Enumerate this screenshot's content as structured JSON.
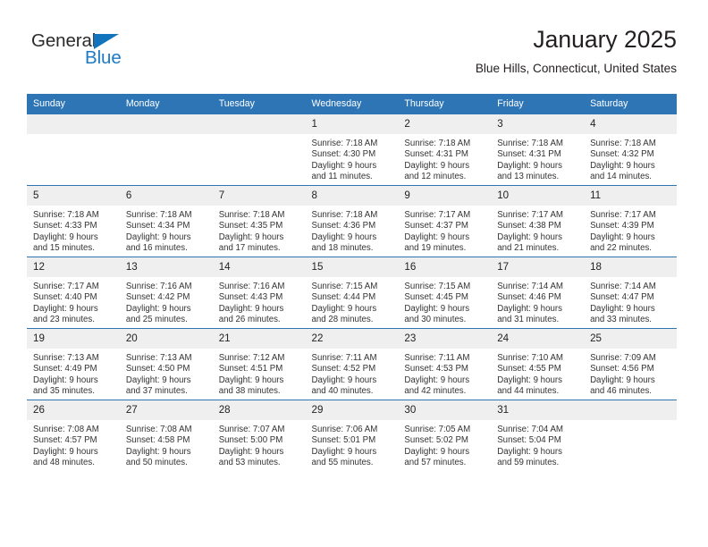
{
  "brand": {
    "name_part1": "General",
    "name_part2": "Blue",
    "logo_icon": "triangle-icon",
    "colors": {
      "blue": "#1d7ac4",
      "dark": "#2b2b2b"
    }
  },
  "header": {
    "title": "January 2025",
    "subtitle": "Blue Hills, Connecticut, United States"
  },
  "theme": {
    "header_blue": "#2e75b6",
    "daynum_background": "#efefef",
    "text": "#231f20"
  },
  "calendar": {
    "weekday_headers": [
      "Sunday",
      "Monday",
      "Tuesday",
      "Wednesday",
      "Thursday",
      "Friday",
      "Saturday"
    ],
    "weeks": [
      [
        {
          "day": "",
          "empty": true,
          "sunrise": "",
          "sunset": "",
          "daylight_line1": "",
          "daylight_line2": ""
        },
        {
          "day": "",
          "empty": true,
          "sunrise": "",
          "sunset": "",
          "daylight_line1": "",
          "daylight_line2": ""
        },
        {
          "day": "",
          "empty": true,
          "sunrise": "",
          "sunset": "",
          "daylight_line1": "",
          "daylight_line2": ""
        },
        {
          "day": "1",
          "empty": false,
          "sunrise": "Sunrise: 7:18 AM",
          "sunset": "Sunset: 4:30 PM",
          "daylight_line1": "Daylight: 9 hours",
          "daylight_line2": "and 11 minutes."
        },
        {
          "day": "2",
          "empty": false,
          "sunrise": "Sunrise: 7:18 AM",
          "sunset": "Sunset: 4:31 PM",
          "daylight_line1": "Daylight: 9 hours",
          "daylight_line2": "and 12 minutes."
        },
        {
          "day": "3",
          "empty": false,
          "sunrise": "Sunrise: 7:18 AM",
          "sunset": "Sunset: 4:31 PM",
          "daylight_line1": "Daylight: 9 hours",
          "daylight_line2": "and 13 minutes."
        },
        {
          "day": "4",
          "empty": false,
          "sunrise": "Sunrise: 7:18 AM",
          "sunset": "Sunset: 4:32 PM",
          "daylight_line1": "Daylight: 9 hours",
          "daylight_line2": "and 14 minutes."
        }
      ],
      [
        {
          "day": "5",
          "empty": false,
          "sunrise": "Sunrise: 7:18 AM",
          "sunset": "Sunset: 4:33 PM",
          "daylight_line1": "Daylight: 9 hours",
          "daylight_line2": "and 15 minutes."
        },
        {
          "day": "6",
          "empty": false,
          "sunrise": "Sunrise: 7:18 AM",
          "sunset": "Sunset: 4:34 PM",
          "daylight_line1": "Daylight: 9 hours",
          "daylight_line2": "and 16 minutes."
        },
        {
          "day": "7",
          "empty": false,
          "sunrise": "Sunrise: 7:18 AM",
          "sunset": "Sunset: 4:35 PM",
          "daylight_line1": "Daylight: 9 hours",
          "daylight_line2": "and 17 minutes."
        },
        {
          "day": "8",
          "empty": false,
          "sunrise": "Sunrise: 7:18 AM",
          "sunset": "Sunset: 4:36 PM",
          "daylight_line1": "Daylight: 9 hours",
          "daylight_line2": "and 18 minutes."
        },
        {
          "day": "9",
          "empty": false,
          "sunrise": "Sunrise: 7:17 AM",
          "sunset": "Sunset: 4:37 PM",
          "daylight_line1": "Daylight: 9 hours",
          "daylight_line2": "and 19 minutes."
        },
        {
          "day": "10",
          "empty": false,
          "sunrise": "Sunrise: 7:17 AM",
          "sunset": "Sunset: 4:38 PM",
          "daylight_line1": "Daylight: 9 hours",
          "daylight_line2": "and 21 minutes."
        },
        {
          "day": "11",
          "empty": false,
          "sunrise": "Sunrise: 7:17 AM",
          "sunset": "Sunset: 4:39 PM",
          "daylight_line1": "Daylight: 9 hours",
          "daylight_line2": "and 22 minutes."
        }
      ],
      [
        {
          "day": "12",
          "empty": false,
          "sunrise": "Sunrise: 7:17 AM",
          "sunset": "Sunset: 4:40 PM",
          "daylight_line1": "Daylight: 9 hours",
          "daylight_line2": "and 23 minutes."
        },
        {
          "day": "13",
          "empty": false,
          "sunrise": "Sunrise: 7:16 AM",
          "sunset": "Sunset: 4:42 PM",
          "daylight_line1": "Daylight: 9 hours",
          "daylight_line2": "and 25 minutes."
        },
        {
          "day": "14",
          "empty": false,
          "sunrise": "Sunrise: 7:16 AM",
          "sunset": "Sunset: 4:43 PM",
          "daylight_line1": "Daylight: 9 hours",
          "daylight_line2": "and 26 minutes."
        },
        {
          "day": "15",
          "empty": false,
          "sunrise": "Sunrise: 7:15 AM",
          "sunset": "Sunset: 4:44 PM",
          "daylight_line1": "Daylight: 9 hours",
          "daylight_line2": "and 28 minutes."
        },
        {
          "day": "16",
          "empty": false,
          "sunrise": "Sunrise: 7:15 AM",
          "sunset": "Sunset: 4:45 PM",
          "daylight_line1": "Daylight: 9 hours",
          "daylight_line2": "and 30 minutes."
        },
        {
          "day": "17",
          "empty": false,
          "sunrise": "Sunrise: 7:14 AM",
          "sunset": "Sunset: 4:46 PM",
          "daylight_line1": "Daylight: 9 hours",
          "daylight_line2": "and 31 minutes."
        },
        {
          "day": "18",
          "empty": false,
          "sunrise": "Sunrise: 7:14 AM",
          "sunset": "Sunset: 4:47 PM",
          "daylight_line1": "Daylight: 9 hours",
          "daylight_line2": "and 33 minutes."
        }
      ],
      [
        {
          "day": "19",
          "empty": false,
          "sunrise": "Sunrise: 7:13 AM",
          "sunset": "Sunset: 4:49 PM",
          "daylight_line1": "Daylight: 9 hours",
          "daylight_line2": "and 35 minutes."
        },
        {
          "day": "20",
          "empty": false,
          "sunrise": "Sunrise: 7:13 AM",
          "sunset": "Sunset: 4:50 PM",
          "daylight_line1": "Daylight: 9 hours",
          "daylight_line2": "and 37 minutes."
        },
        {
          "day": "21",
          "empty": false,
          "sunrise": "Sunrise: 7:12 AM",
          "sunset": "Sunset: 4:51 PM",
          "daylight_line1": "Daylight: 9 hours",
          "daylight_line2": "and 38 minutes."
        },
        {
          "day": "22",
          "empty": false,
          "sunrise": "Sunrise: 7:11 AM",
          "sunset": "Sunset: 4:52 PM",
          "daylight_line1": "Daylight: 9 hours",
          "daylight_line2": "and 40 minutes."
        },
        {
          "day": "23",
          "empty": false,
          "sunrise": "Sunrise: 7:11 AM",
          "sunset": "Sunset: 4:53 PM",
          "daylight_line1": "Daylight: 9 hours",
          "daylight_line2": "and 42 minutes."
        },
        {
          "day": "24",
          "empty": false,
          "sunrise": "Sunrise: 7:10 AM",
          "sunset": "Sunset: 4:55 PM",
          "daylight_line1": "Daylight: 9 hours",
          "daylight_line2": "and 44 minutes."
        },
        {
          "day": "25",
          "empty": false,
          "sunrise": "Sunrise: 7:09 AM",
          "sunset": "Sunset: 4:56 PM",
          "daylight_line1": "Daylight: 9 hours",
          "daylight_line2": "and 46 minutes."
        }
      ],
      [
        {
          "day": "26",
          "empty": false,
          "sunrise": "Sunrise: 7:08 AM",
          "sunset": "Sunset: 4:57 PM",
          "daylight_line1": "Daylight: 9 hours",
          "daylight_line2": "and 48 minutes."
        },
        {
          "day": "27",
          "empty": false,
          "sunrise": "Sunrise: 7:08 AM",
          "sunset": "Sunset: 4:58 PM",
          "daylight_line1": "Daylight: 9 hours",
          "daylight_line2": "and 50 minutes."
        },
        {
          "day": "28",
          "empty": false,
          "sunrise": "Sunrise: 7:07 AM",
          "sunset": "Sunset: 5:00 PM",
          "daylight_line1": "Daylight: 9 hours",
          "daylight_line2": "and 53 minutes."
        },
        {
          "day": "29",
          "empty": false,
          "sunrise": "Sunrise: 7:06 AM",
          "sunset": "Sunset: 5:01 PM",
          "daylight_line1": "Daylight: 9 hours",
          "daylight_line2": "and 55 minutes."
        },
        {
          "day": "30",
          "empty": false,
          "sunrise": "Sunrise: 7:05 AM",
          "sunset": "Sunset: 5:02 PM",
          "daylight_line1": "Daylight: 9 hours",
          "daylight_line2": "and 57 minutes."
        },
        {
          "day": "31",
          "empty": false,
          "sunrise": "Sunrise: 7:04 AM",
          "sunset": "Sunset: 5:04 PM",
          "daylight_line1": "Daylight: 9 hours",
          "daylight_line2": "and 59 minutes."
        },
        {
          "day": "",
          "empty": true,
          "sunrise": "",
          "sunset": "",
          "daylight_line1": "",
          "daylight_line2": ""
        }
      ]
    ]
  }
}
